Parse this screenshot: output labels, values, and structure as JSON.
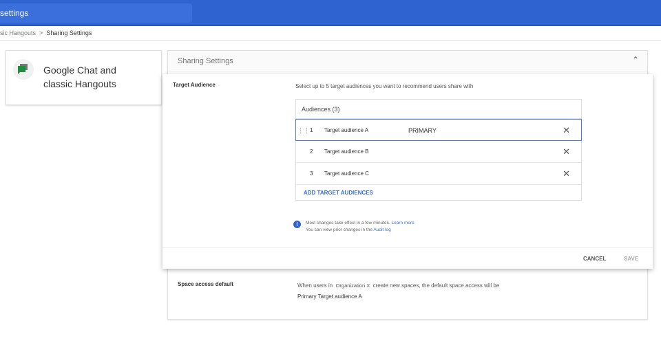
{
  "search": {
    "value": "settings"
  },
  "breadcrumb": {
    "parent": "sic Hangouts",
    "current": "Sharing Settings"
  },
  "app": {
    "name": "Google Chat and classic Hangouts"
  },
  "panel": {
    "title": "Sharing Settings"
  },
  "dialog": {
    "label": "Target Audience",
    "description": "Select up to 5 target audiences you want to recommend users share with",
    "audiences_header": "Audiences (3)",
    "audiences": [
      {
        "n": "1",
        "name": "Target audience A",
        "badge": "PRIMARY"
      },
      {
        "n": "2",
        "name": "Target audience B"
      },
      {
        "n": "3",
        "name": "Target audience C"
      }
    ],
    "add_label": "ADD TARGET AUDIENCES",
    "note1": "Most changes take effect in a few minutes.",
    "learn_more": "Learn more",
    "note2": "You can view prior changes in the",
    "audit_log": "Audit log",
    "cancel": "CANCEL",
    "save": "SAVE"
  },
  "space": {
    "label": "Space access default",
    "desc_pre": "When users in",
    "org": "Organization X",
    "desc_post": "create new spaces, the default space access will be",
    "value": "Primary Target audience A"
  }
}
